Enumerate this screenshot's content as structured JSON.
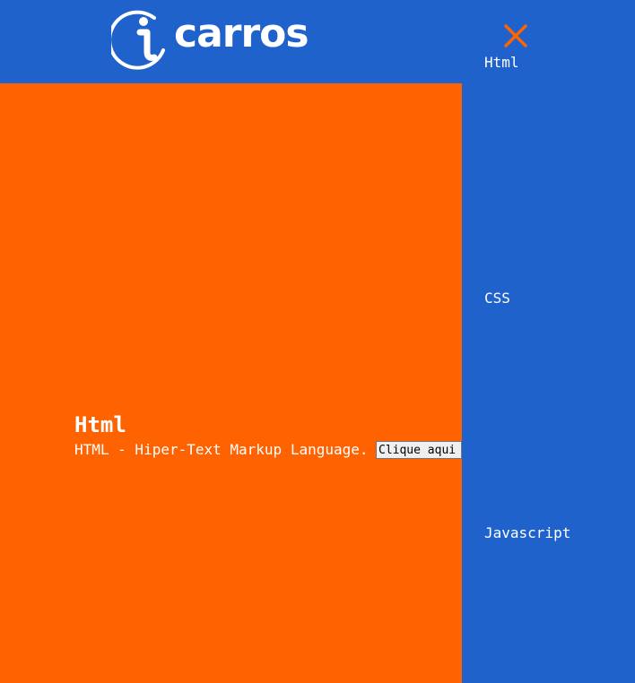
{
  "header": {
    "logo_text": "carros",
    "close_icon": "close-icon"
  },
  "menu": {
    "items": [
      {
        "label": "Html"
      },
      {
        "label": "CSS"
      },
      {
        "label": "Javascript"
      }
    ]
  },
  "content": {
    "title": "Html",
    "description": "HTML - Hiper-Text Markup Language.",
    "button_label": "Clique aqui"
  },
  "colors": {
    "primary_blue": "#2062cc",
    "accent_orange": "#ff6200",
    "text_white": "#ffffff"
  }
}
